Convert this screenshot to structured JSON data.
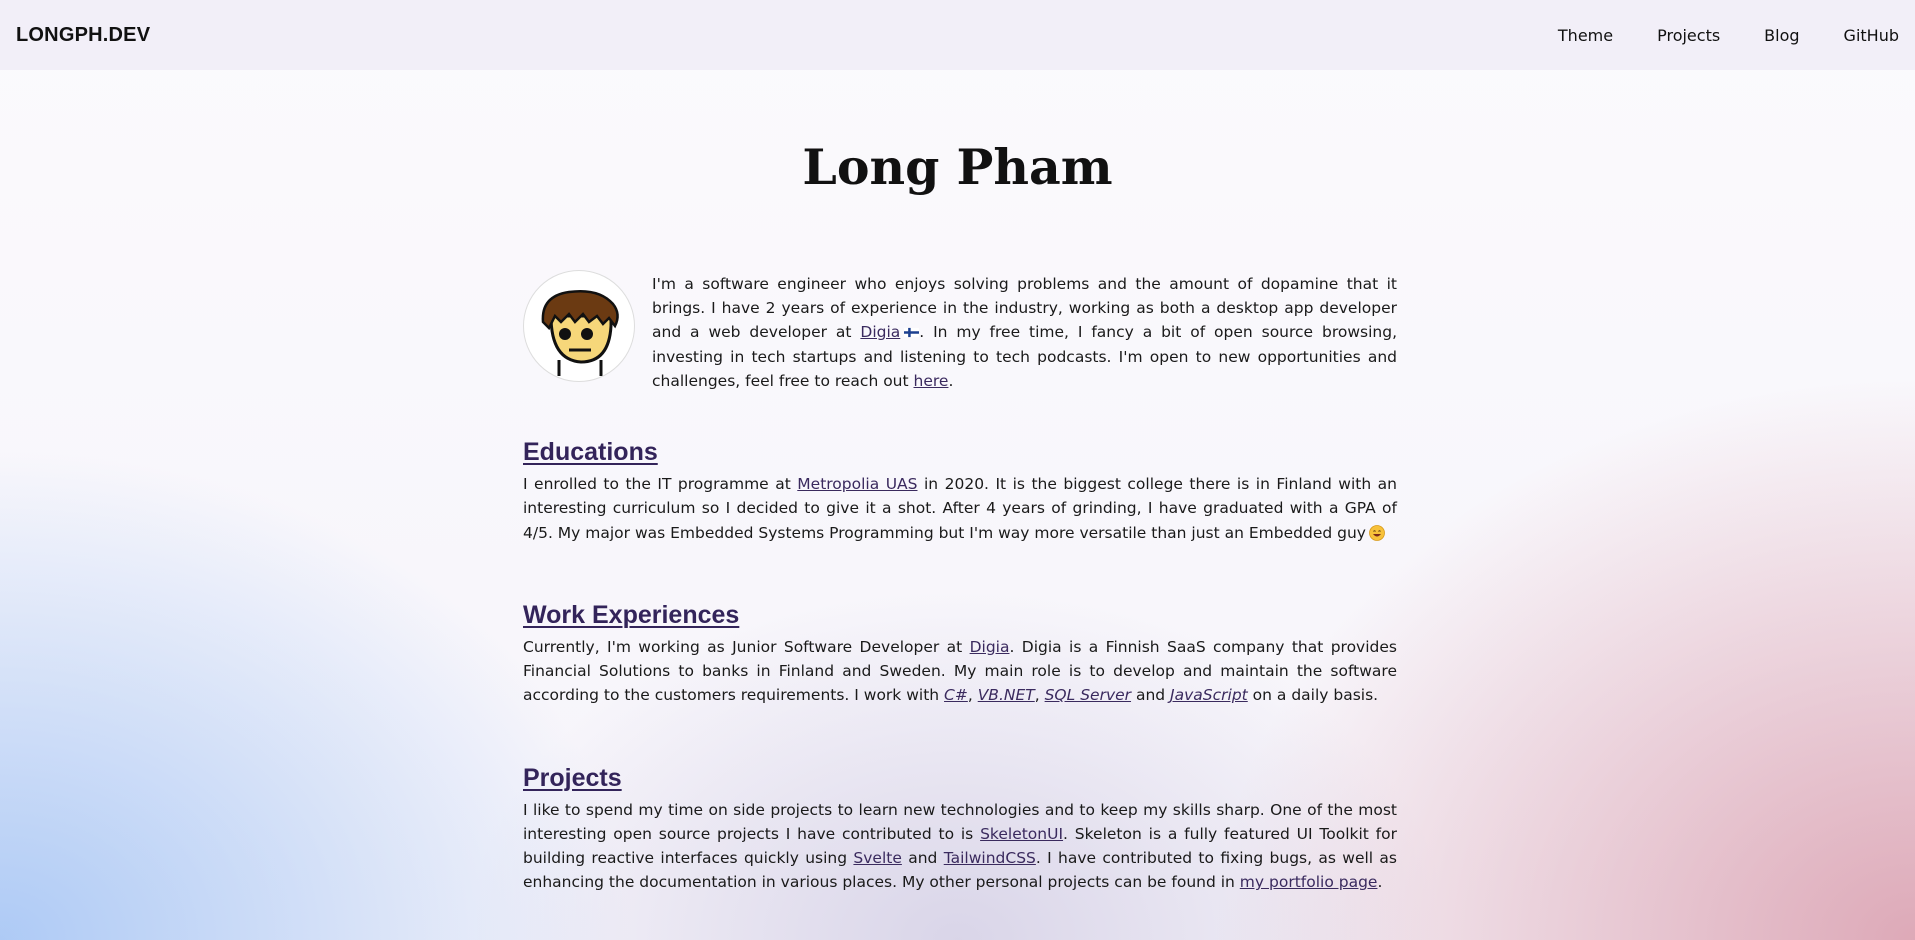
{
  "header": {
    "brand": "LONGPH.DEV",
    "nav": [
      "Theme",
      "Projects",
      "Blog",
      "GitHub"
    ]
  },
  "page_title": "Long Pham",
  "intro": {
    "t1": "I'm a software engineer who enjoys solving problems and the amount of dopamine that it brings. I have 2 years of experience in the industry, working as both a desktop app developer and a web developer at ",
    "link_digia": "Digia",
    "t2": ". In my free time, I fancy a bit of open source browsing, investing in tech startups and listening to tech podcasts. I'm open to new opportunities and challenges, feel free to reach out ",
    "link_here": "here",
    "t3": "."
  },
  "education": {
    "heading": "Educations",
    "t1": "I enrolled to the IT programme at ",
    "link_metropolia": "Metropolia UAS",
    "t2": " in 2020. It is the biggest college there is in Finland with an interesting curriculum so I decided to give it a shot. After 4 years of grinding, I have graduated with a GPA of 4/5. My major was Embedded Systems Programming but I'm way more versatile than just an Embedded guy"
  },
  "work": {
    "heading": "Work Experiences",
    "t1": "Currently, I'm working as Junior Software Developer at ",
    "link_digia": "Digia",
    "t2": ". Digia is a Finnish SaaS company that provides Financial Solutions to banks in Finland and Sweden. My main role is to develop and maintain the software according to the customers requirements. I work with ",
    "tech": [
      "C#",
      "VB.NET",
      "SQL Server",
      "JavaScript"
    ],
    "sep1": ", ",
    "sep2": ", ",
    "sep3": " and ",
    "t3": " on a daily basis."
  },
  "projects": {
    "heading": "Projects",
    "t1": "I like to spend my time on side projects to learn new technologies and to keep my skills sharp. One of the most interesting open source projects I have contributed to is ",
    "link_skeleton": "SkeletonUI",
    "t2": ". Skeleton is a fully featured UI Toolkit for building reactive interfaces quickly using ",
    "link_svelte": "Svelte",
    "t3": " and ",
    "link_tailwind": "TailwindCSS",
    "t4": ". I have contributed to fixing bugs, as well as enhancing the documentation in various places. My other personal projects can be found in ",
    "link_portfolio": "my portfolio page",
    "t5": "."
  },
  "icons": {
    "avatar": "cartoon-avatar",
    "flag": "finland-flag-icon",
    "emoji": "grinning-face-emoji"
  },
  "colors": {
    "header_bg": "#f2eff8",
    "heading": "#33245a",
    "link": "#3a2a5e"
  }
}
